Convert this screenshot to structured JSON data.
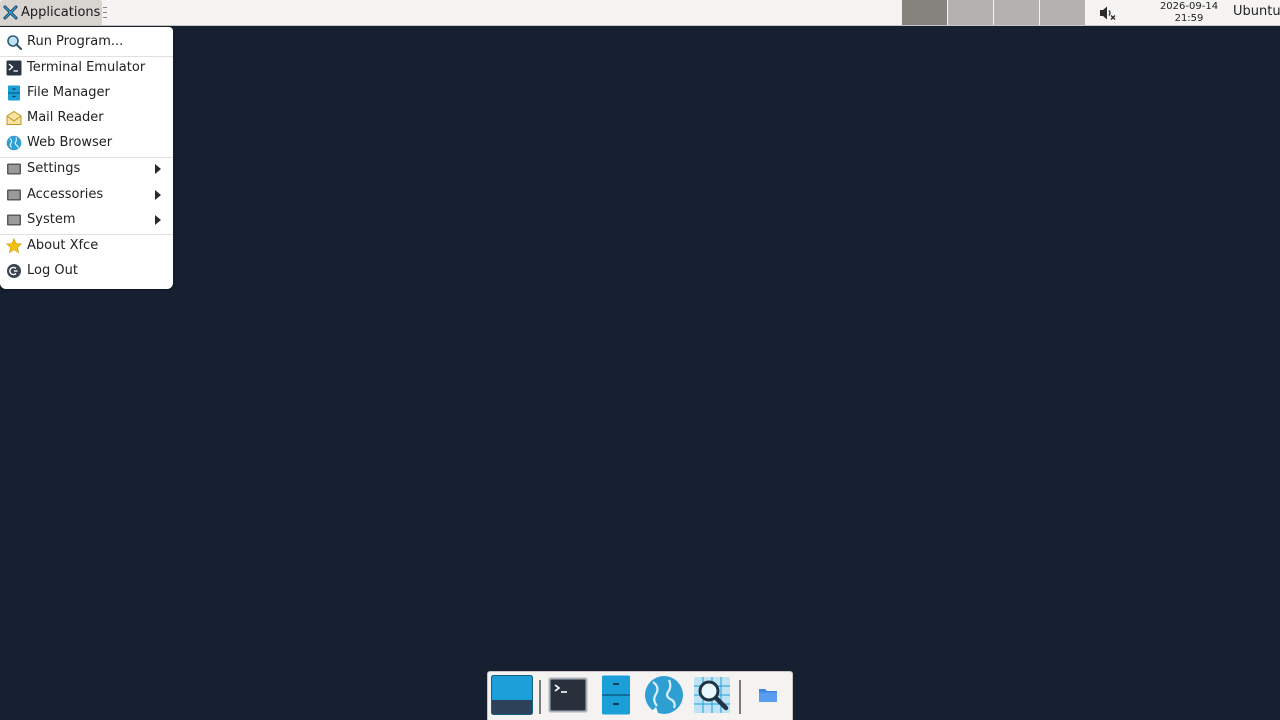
{
  "top_panel": {
    "applications_label": "Applications",
    "workspaces": [
      {
        "active": true
      },
      {
        "active": false
      },
      {
        "active": false
      },
      {
        "active": false
      }
    ],
    "clock": {
      "date": "2026-09-14",
      "time": "21:59"
    },
    "user": "Ubuntu",
    "icons": {
      "menu": "xfce-logo-icon",
      "volume": "volume-muted-icon"
    }
  },
  "app_menu": {
    "items": [
      {
        "label": "Run Program...",
        "icon": "run-program-icon"
      },
      {
        "label": "Terminal Emulator",
        "icon": "terminal-icon"
      },
      {
        "label": "File Manager",
        "icon": "file-manager-icon"
      },
      {
        "label": "Mail Reader",
        "icon": "mail-icon"
      },
      {
        "label": "Web Browser",
        "icon": "web-browser-icon"
      },
      {
        "label": "Settings",
        "icon": "settings-folder-icon",
        "submenu": true
      },
      {
        "label": "Accessories",
        "icon": "accessories-folder-icon",
        "submenu": true
      },
      {
        "label": "System",
        "icon": "system-folder-icon",
        "submenu": true
      },
      {
        "label": "About Xfce",
        "icon": "star-icon"
      },
      {
        "label": "Log Out",
        "icon": "logout-icon"
      }
    ]
  },
  "dock": {
    "items": [
      {
        "icon": "show-desktop-icon"
      },
      {
        "icon": "terminal-icon"
      },
      {
        "icon": "file-manager-icon"
      },
      {
        "icon": "web-browser-icon"
      },
      {
        "icon": "app-finder-icon"
      },
      {
        "icon": "folder-icon"
      }
    ]
  },
  "colors": {
    "desktop_bg": "#162031",
    "panel_bg": "#f5f4f3",
    "accent": "#1a9fd8"
  }
}
